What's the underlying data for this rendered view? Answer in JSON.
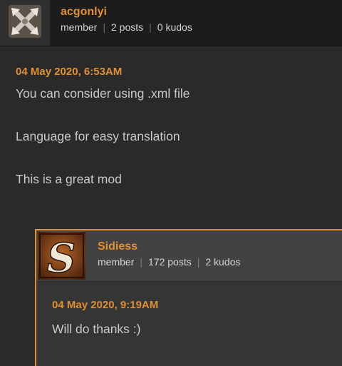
{
  "post": {
    "author": "acgonlyi",
    "role": "member",
    "posts": "2 posts",
    "kudos": "0 kudos",
    "avatar_icon": "crossed-swords-x-icon",
    "date": "04 May 2020, 6:53AM",
    "lines": [
      "You can consider using .xml file",
      "Language for easy translation",
      "This is a great mod"
    ]
  },
  "reply": {
    "author": "Sidiess",
    "role": "member",
    "posts": "172 posts",
    "kudos": "2 kudos",
    "avatar_icon": "letter-s-icon",
    "avatar_letter": "S",
    "date": "04 May 2020, 9:19AM",
    "text": "Will do thanks :)"
  },
  "colors": {
    "accent": "#e08f35",
    "background": "#2a2a2a",
    "header_background": "#1c1c1c",
    "text": "#c9c9c9"
  }
}
